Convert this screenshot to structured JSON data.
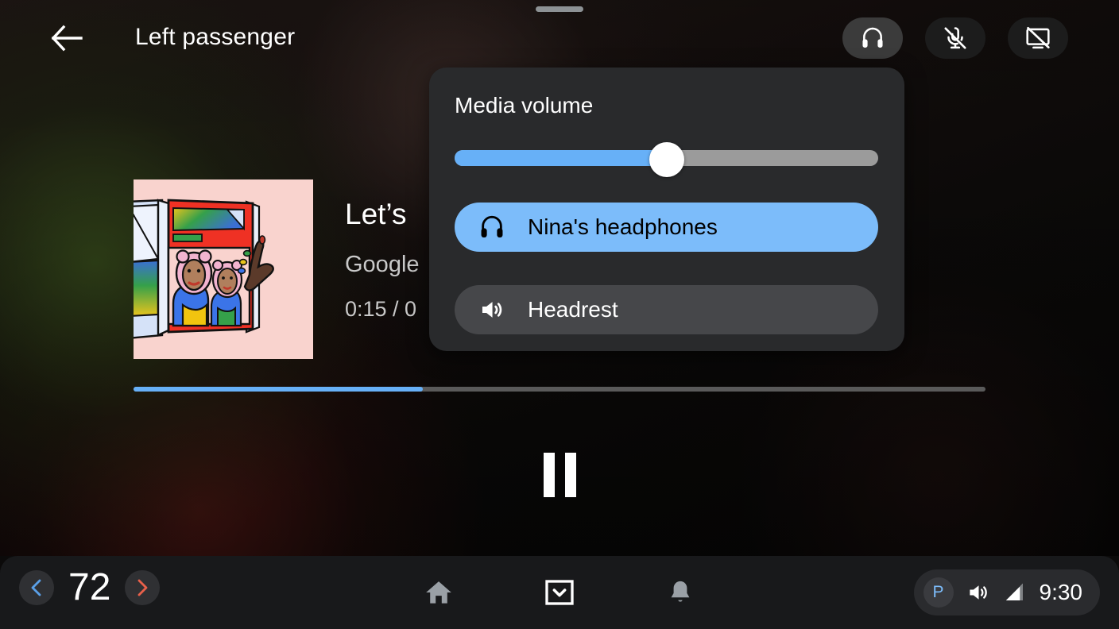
{
  "window": {
    "drag_handle": "drag-handle"
  },
  "top_bar": {
    "back_label": "back-arrow-icon",
    "title": "Left passenger",
    "actions": [
      {
        "name": "headphones",
        "icon": "headphones-icon",
        "active": true
      },
      {
        "name": "mic-off",
        "icon": "mic-off-icon",
        "active": false
      },
      {
        "name": "screen-off",
        "icon": "screen-off-icon",
        "active": false
      }
    ]
  },
  "media": {
    "album_art": "album-art-magazine-illustration",
    "title": "Let’s",
    "artist": "Google",
    "time": "0:15 / 0",
    "progress_percent": 34,
    "transport": {
      "state": "playing",
      "button_label": "pause-button"
    }
  },
  "volume_popup": {
    "title": "Media volume",
    "slider_percent": 50,
    "devices": [
      {
        "label": "Nina's headphones",
        "icon": "headphones-icon",
        "selected": true
      },
      {
        "label": "Headrest",
        "icon": "speaker-icon",
        "selected": false
      }
    ]
  },
  "bottom_bar": {
    "temperature": {
      "value": "72",
      "decrease_icon": "chevron-left-icon",
      "increase_icon": "chevron-right-icon",
      "decrease_color": "#5aa0e8",
      "increase_color": "#e8604a"
    },
    "nav": [
      {
        "name": "home",
        "icon": "home-icon"
      },
      {
        "name": "app-grid",
        "icon": "chevron-down-boxed-icon"
      },
      {
        "name": "notifications",
        "icon": "bell-icon"
      }
    ],
    "status": {
      "park_label": "P",
      "volume_icon": "speaker-icon",
      "signal_icon": "signal-bars-icon",
      "time": "9:30"
    }
  },
  "colors": {
    "accent_blue": "#67b0f7",
    "device_selected": "#7cbcfa",
    "popup_bg": "#292a2c",
    "bottom_bar_bg": "#18191b",
    "park_blue": "#7cbcfa"
  }
}
